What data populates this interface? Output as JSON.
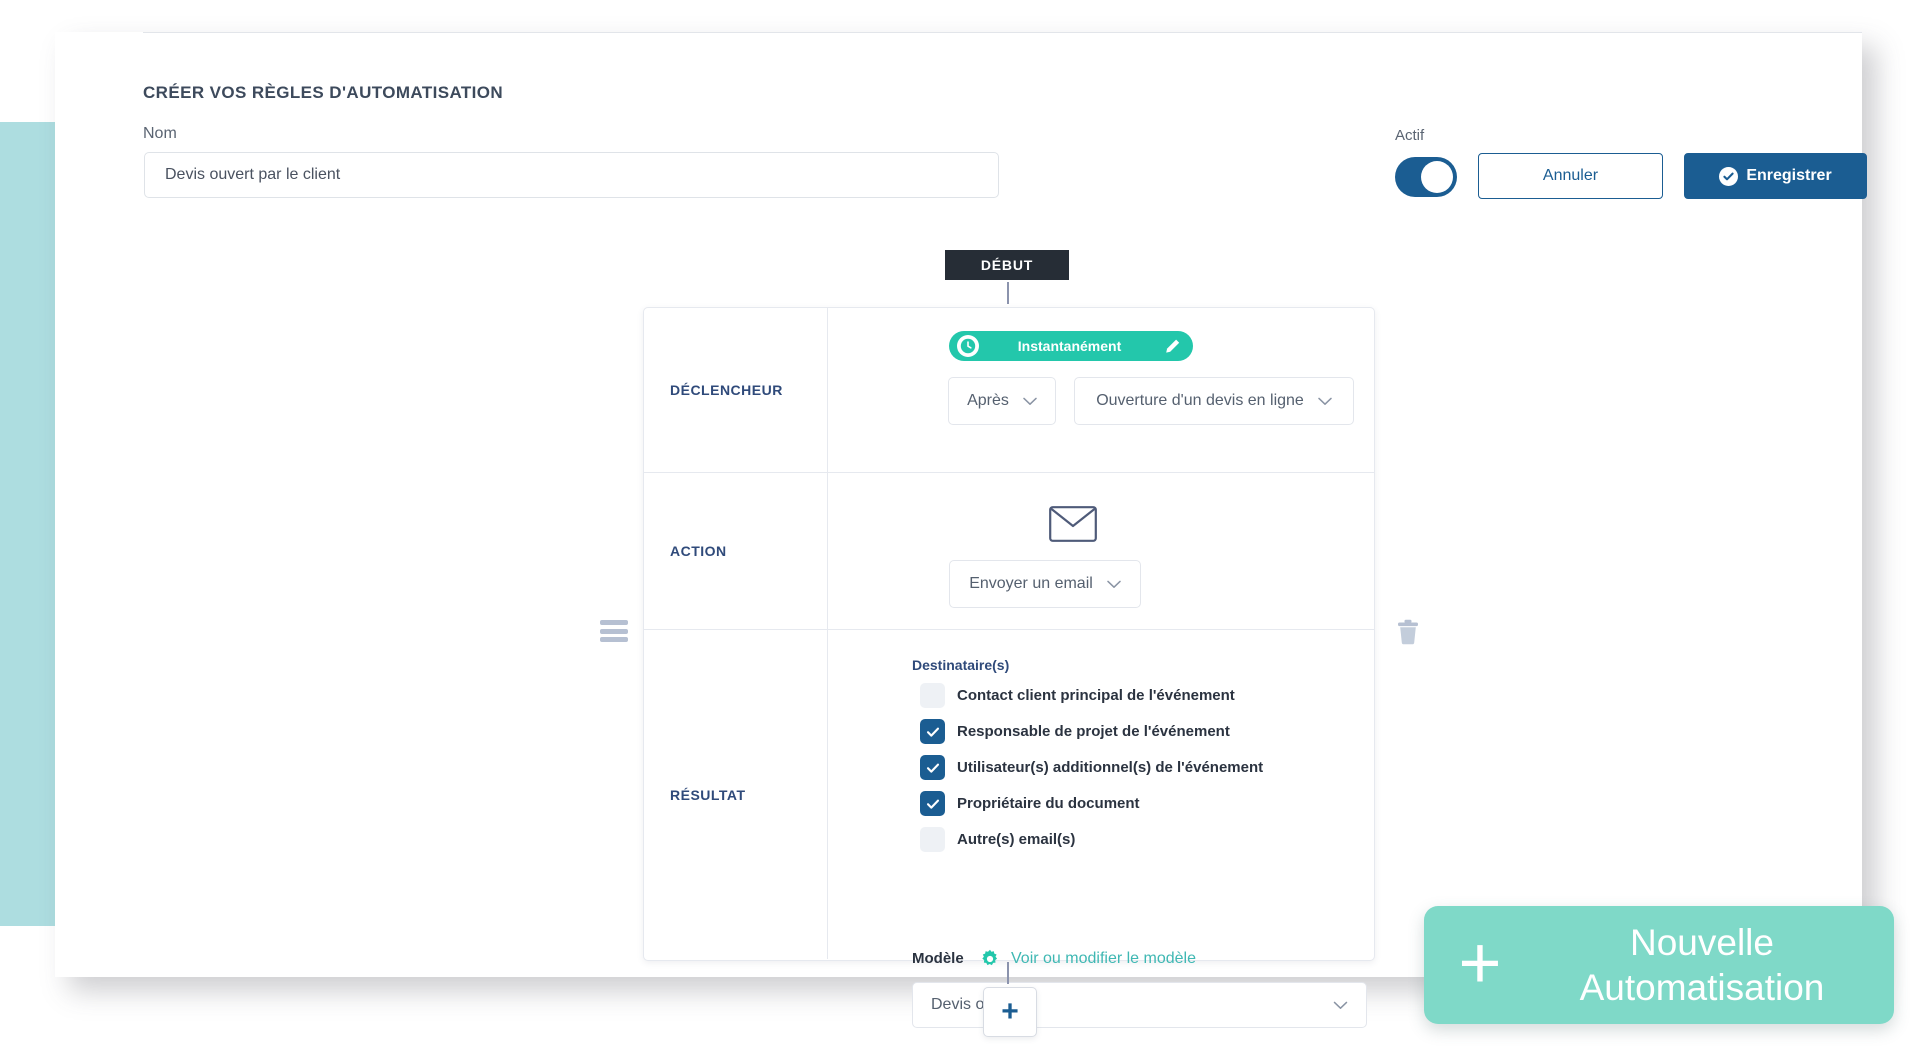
{
  "header": {
    "title": "CRÉER VOS RÈGLES D'AUTOMATISATION",
    "name_label": "Nom",
    "name_value": "Devis ouvert par le client",
    "name_placeholder": "Nom",
    "active_label": "Actif",
    "active_state": "on",
    "cancel_label": "Annuler",
    "save_label": "Enregistrer"
  },
  "flow": {
    "start_badge": "DÉBUT",
    "trigger": {
      "label": "DÉCLENCHEUR",
      "timing_pill": "Instantanément",
      "when_select": "Après",
      "event_select": "Ouverture d'un devis en ligne"
    },
    "action": {
      "label": "ACTION",
      "action_select": "Envoyer un email"
    },
    "result": {
      "label": "RÉSULTAT",
      "recipients_label": "Destinataire(s)",
      "recipients": [
        {
          "label": "Contact client principal de l'événement",
          "checked": false
        },
        {
          "label": "Responsable de projet de l'événement",
          "checked": true
        },
        {
          "label": "Utilisateur(s) additionnel(s) de l'événement",
          "checked": true
        },
        {
          "label": "Propriétaire du document",
          "checked": true
        },
        {
          "label": "Autre(s) email(s)",
          "checked": false
        }
      ],
      "template_label": "Modèle",
      "template_link": "Voir ou modifier le modèle",
      "template_select": "Devis ouvert"
    },
    "add_step_label": "+"
  },
  "cta": {
    "plus": "+",
    "line1": "Nouvelle",
    "line2": "Automatisation"
  },
  "colors": {
    "brand_teal": "#23c7ab",
    "cta_teal": "#7fd9c8",
    "panel_teal": "#addde0",
    "primary_blue": "#1b5d92",
    "label_blue": "#2f4a7a",
    "dark_badge": "#262d36"
  }
}
